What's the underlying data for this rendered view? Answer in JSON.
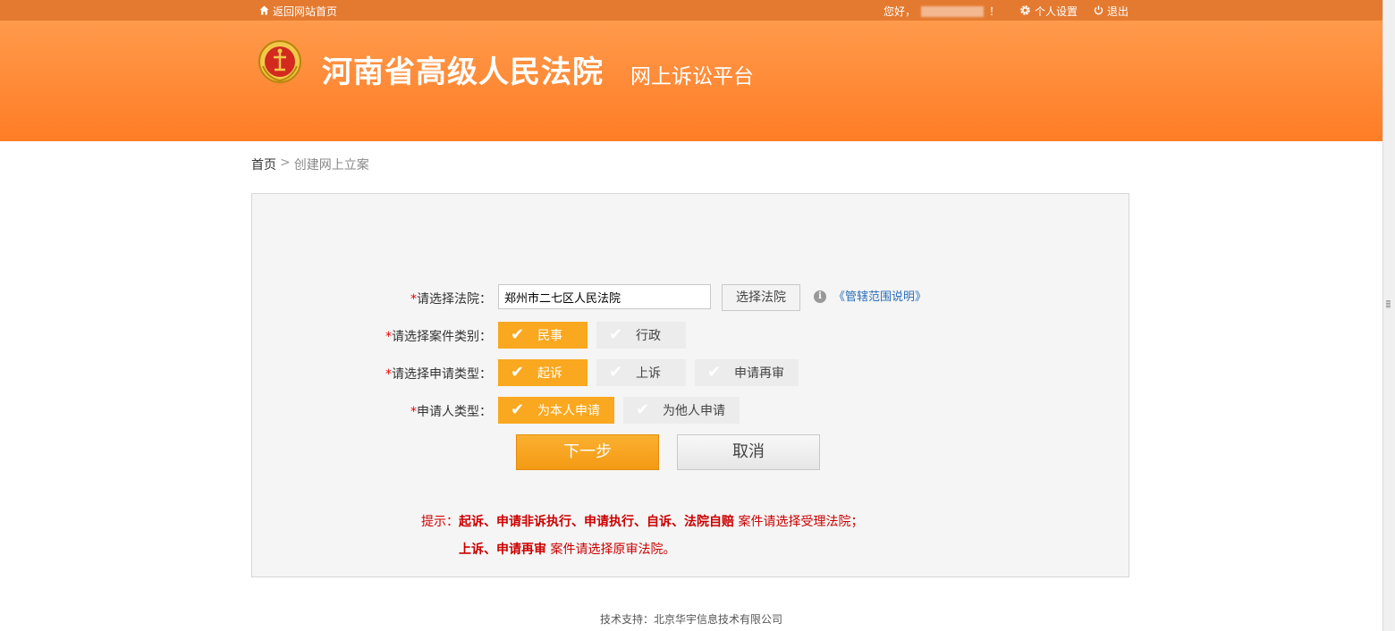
{
  "topbar": {
    "home_link": "返回网站首页",
    "greeting": "您好，",
    "greeting_end": "！",
    "settings": "个人设置",
    "logout": "退出"
  },
  "header": {
    "court_name": "河南省高级人民法院",
    "platform_name": "网上诉讼平台"
  },
  "breadcrumb": {
    "home": "首页",
    "separator": ">",
    "current": "创建网上立案"
  },
  "form": {
    "required_mark": "*",
    "court": {
      "label": "请选择法院：",
      "value": "郑州市二七区人民法院",
      "choose_button": "选择法院",
      "info_icon": "i",
      "scope_link": "《管辖范围说明》"
    },
    "case_category": {
      "label": "请选择案件类别：",
      "options": [
        {
          "label": "民事",
          "selected": true
        },
        {
          "label": "行政",
          "selected": false
        }
      ]
    },
    "application_type": {
      "label": "请选择申请类型：",
      "options": [
        {
          "label": "起诉",
          "selected": true
        },
        {
          "label": "上诉",
          "selected": false
        },
        {
          "label": "申请再审",
          "selected": false
        }
      ]
    },
    "applicant_type": {
      "label": "申请人类型：",
      "options": [
        {
          "label": "为本人申请",
          "selected": true
        },
        {
          "label": "为他人申请",
          "selected": false
        }
      ]
    },
    "next_button": "下一步",
    "cancel_button": "取消"
  },
  "tips": {
    "prefix": "提示：",
    "line1_bold": "起诉、申请非诉执行、申请执行、自诉、法院自赔",
    "line1_rest": " 案件请选择受理法院；",
    "line2_bold": "上诉、申请再审",
    "line2_rest": " 案件请选择原审法院。"
  },
  "footer": {
    "text": "技术支持：北京华宇信息技术有限公司"
  },
  "icons": {
    "home": "home-icon",
    "settings": "gear-icon",
    "logout": "power-icon",
    "emblem": "court-emblem-icon",
    "check": "check-icon",
    "info": "info-icon"
  },
  "colors": {
    "topbar": "#e47a30",
    "banner": "#ff8a35",
    "selected_option": "#f9a81f",
    "tip_text": "#cc0000",
    "link": "#2a6fb8"
  }
}
